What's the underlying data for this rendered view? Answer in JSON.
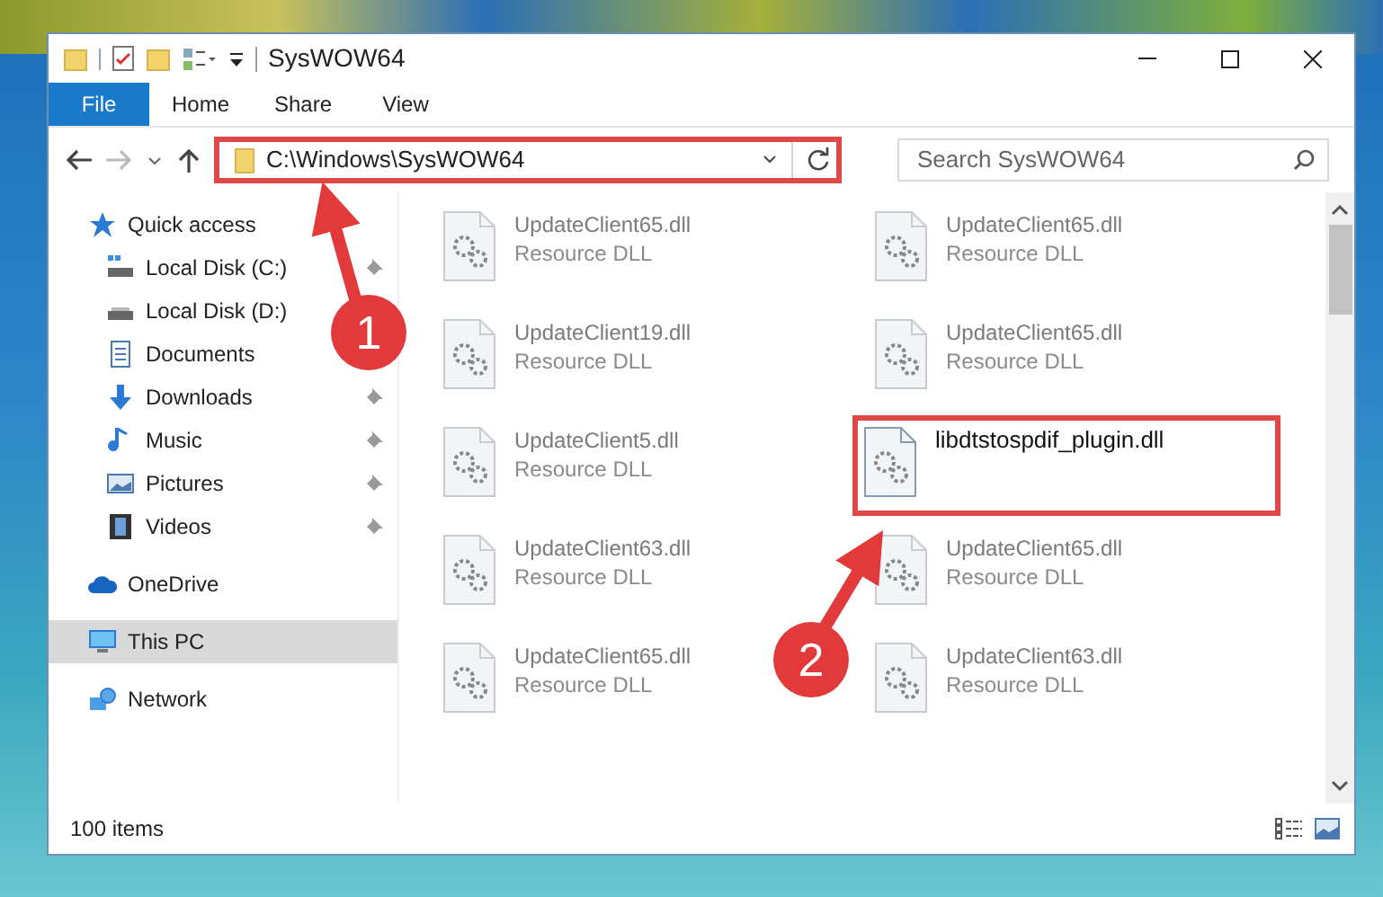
{
  "window": {
    "title": "SysWOW64"
  },
  "ribbon_tabs": [
    {
      "label": "File",
      "kind": "file",
      "selected": false
    },
    {
      "label": "Home",
      "kind": "tab",
      "selected": false
    },
    {
      "label": "Share",
      "kind": "tab",
      "selected": false
    },
    {
      "label": "View",
      "kind": "tab",
      "selected": false
    }
  ],
  "address": {
    "path": "C:\\Windows\\SysWOW64",
    "highlighted": true
  },
  "search": {
    "placeholder": "Search SysWOW64"
  },
  "sidebar": {
    "items": [
      {
        "label": "Quick access",
        "kind": "star",
        "selected": false,
        "children": [
          {
            "label": "Local Disk (C:)",
            "kind": "system-disk",
            "pinned": true,
            "selected": false
          },
          {
            "label": "Local Disk (D:)",
            "kind": "disk",
            "selected": false
          },
          {
            "label": "Documents",
            "kind": "document",
            "selected": false
          },
          {
            "label": "Downloads",
            "kind": "download",
            "pinned": true,
            "selected": false
          },
          {
            "label": "Music",
            "kind": "music",
            "pinned": true,
            "selected": false
          },
          {
            "label": "Pictures",
            "kind": "picture",
            "pinned": true,
            "selected": false
          },
          {
            "label": "Videos",
            "kind": "video",
            "pinned": true,
            "selected": false
          }
        ]
      },
      {
        "label": "OneDrive",
        "kind": "cloud",
        "selected": false
      },
      {
        "label": "This PC",
        "kind": "pc",
        "selected": true
      },
      {
        "label": "Network",
        "kind": "network",
        "selected": false
      }
    ]
  },
  "files": [
    {
      "name": "UpdateClient65.dll",
      "type": "Resource DLL",
      "dimmed": true,
      "highlighted": false
    },
    {
      "name": "UpdateClient65.dll",
      "type": "Resource DLL",
      "dimmed": true,
      "highlighted": false
    },
    {
      "name": "UpdateClient19.dll",
      "type": "Resource DLL",
      "dimmed": true,
      "highlighted": false
    },
    {
      "name": "UpdateClient65.dll",
      "type": "Resource DLL",
      "dimmed": true,
      "highlighted": false
    },
    {
      "name": "UpdateClient5.dll",
      "type": "Resource DLL",
      "dimmed": true,
      "highlighted": false
    },
    {
      "name": "libdtstospdif_plugin.dll",
      "dimmed": false,
      "highlighted": true
    },
    {
      "name": "UpdateClient63.dll",
      "type": "Resource DLL",
      "dimmed": true,
      "highlighted": false
    },
    {
      "name": "UpdateClient65.dll",
      "type": "Resource DLL",
      "dimmed": true,
      "highlighted": false
    },
    {
      "name": "UpdateClient65.dll",
      "type": "Resource DLL",
      "dimmed": true,
      "highlighted": false
    },
    {
      "name": "UpdateClient63.dll",
      "type": "Resource DLL",
      "dimmed": true,
      "highlighted": false
    }
  ],
  "status_bar": {
    "text": "100 items"
  },
  "annotations": [
    {
      "label": "1"
    },
    {
      "label": "2"
    }
  ]
}
